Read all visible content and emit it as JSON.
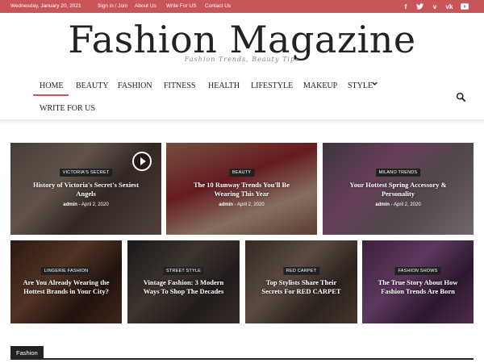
{
  "topbar": {
    "date": "Wednesday, January 20, 2021",
    "links": [
      "Sign in / Join",
      "About Us",
      "Write For US",
      "Contact Us"
    ],
    "social_icons": [
      "facebook-icon",
      "twitter-icon",
      "vimeo-icon",
      "vk-icon",
      "youtube-icon"
    ],
    "color": "#c9555b"
  },
  "site": {
    "title": "Fashion Magazine",
    "tagline": "Fashion Trends, Beauty Tips"
  },
  "nav": {
    "items": [
      "HOME",
      "BEAUTY",
      "FASHION",
      "FITNESS",
      "HEALTH",
      "LIFESTYLE",
      "MAKEUP",
      "STYLE",
      "WRITE FOR US"
    ],
    "dropdown_indicator": "⌄"
  },
  "featured": [
    {
      "category": "VICTORIA'S SECRET",
      "title_lines": [
        "History of Victoria's Secret's Sexiest",
        "Angels"
      ],
      "author": "admin",
      "date": "April 2, 2020"
    },
    {
      "category": "BEAUTY",
      "title_lines": [
        "The 10 Runway Trends You'll Be",
        "Wearing This Year"
      ],
      "author": "admin",
      "date": "April 2, 2020"
    },
    {
      "category": "MILANO TRENDS",
      "title_lines": [
        "Your Hottest Spring Accessory &",
        "Personality"
      ],
      "author": "admin",
      "date": "April 2, 2020"
    }
  ],
  "secondary": [
    {
      "category": "LINGERIE FASHION",
      "title_lines": [
        "Are You Already Wearing the",
        "Hottest Brands in Your City?"
      ]
    },
    {
      "category": "STREET STYLE",
      "title_lines": [
        "Vintage Fashion: 3 Modern",
        "Ways To Shop The Decades"
      ]
    },
    {
      "category": "RED CARPET",
      "title_lines": [
        "Top Stylists Share Their",
        "Secrets For RED CARPET"
      ]
    },
    {
      "category": "FASHION SHOWS",
      "title_lines": [
        "The True Story About How",
        "Fashion Trends Are Born"
      ]
    }
  ],
  "section": {
    "label": "Fashion"
  }
}
